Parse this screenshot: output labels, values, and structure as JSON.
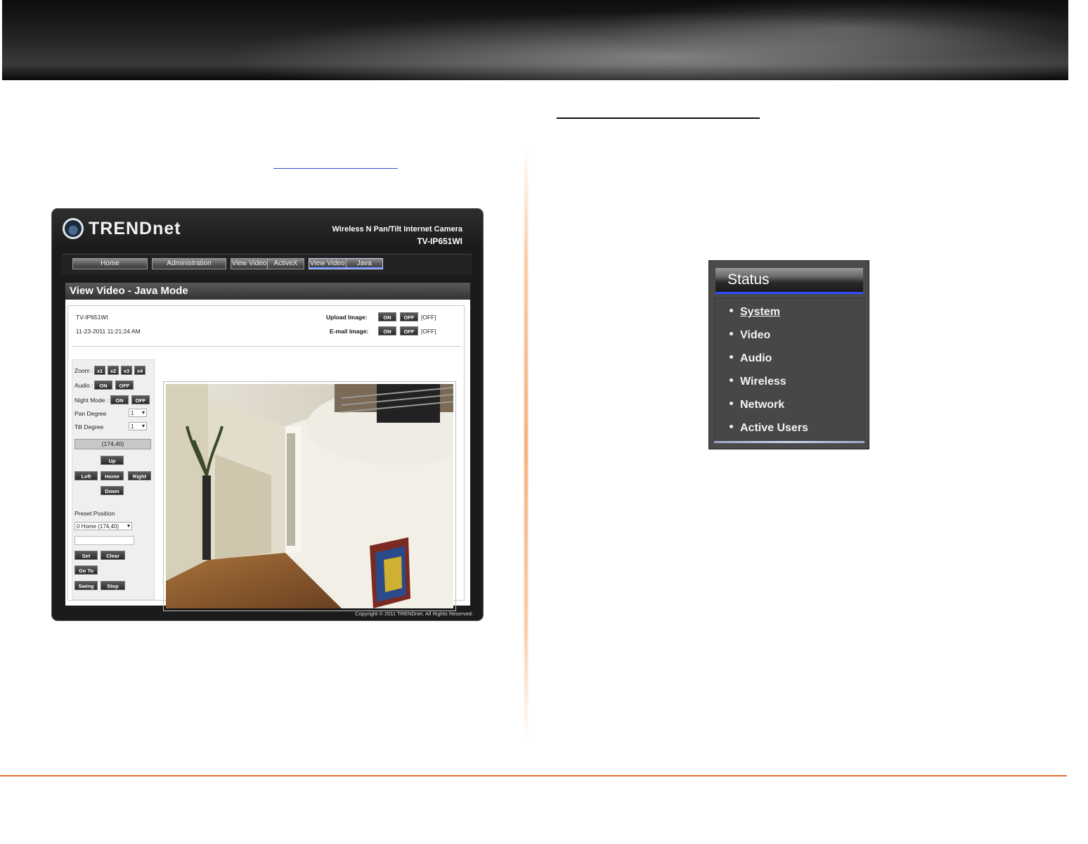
{
  "camera_ui": {
    "brand": "TRENDnet",
    "product_title": "Wireless N Pan/Tilt Internet Camera",
    "model": "TV-IP651WI",
    "nav": {
      "home": "Home",
      "administration": "Administration",
      "activex_left": "View Video",
      "activex_right": "ActiveX",
      "java_left": "View Video",
      "java_right": "Java"
    },
    "panel_title": "View Video - Java Mode",
    "device_name": "TV-IP651WI",
    "timestamp": "11-23-2011 11:21:24 AM",
    "upload_label": "Upload Image:",
    "email_label": "E-mail Image:",
    "on": "ON",
    "off": "OFF",
    "upload_state": "[OFF]",
    "email_state": "[OFF]",
    "zoom_label": "Zoom :",
    "zoom_options": [
      "x1",
      "x2",
      "x3",
      "x4"
    ],
    "audio_label": "Audio :",
    "night_label": "Night Mode :",
    "pan_label": "Pan Degree",
    "pan_value": "1",
    "tilt_label": "Tilt Degree",
    "tilt_value": "1",
    "coords": "(174,40)",
    "up": "Up",
    "left": "Left",
    "home_btn": "Home",
    "right": "Right",
    "down": "Down",
    "preset_label": "Preset Position",
    "preset_value": "0 Home (174,40)",
    "set": "Set",
    "clear": "Clear",
    "goto": "Go To",
    "swing": "Swing",
    "stop": "Stop",
    "copyright": "Copyright © 2011 TRENDnet. All Rights Reserved."
  },
  "status_menu": {
    "title": "Status",
    "items": [
      "System",
      "Video",
      "Audio",
      "Wireless",
      "Network",
      "Active Users"
    ],
    "selected": "System"
  },
  "colors": {
    "divider_accent": "#e07030",
    "menu_highlight": "#2f4dff",
    "link_underline": "#2a4fd8"
  }
}
